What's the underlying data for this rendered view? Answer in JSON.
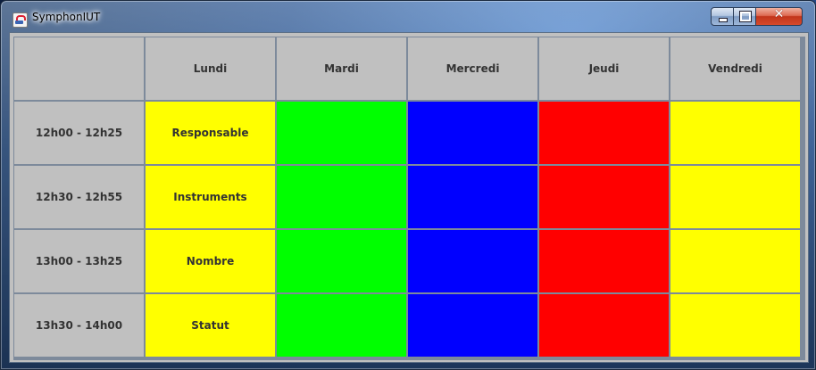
{
  "window": {
    "title": "SymphonIUT",
    "close_glyph": "✕"
  },
  "icons": {
    "app": "java-coffee-cup-icon",
    "minimize": "minimize-icon",
    "maximize": "maximize-icon",
    "close": "close-icon"
  },
  "colors": {
    "header_bg": "#c0c0c0",
    "lundi": "#ffff00",
    "mardi": "#00ff00",
    "mercredi": "#0000ff",
    "jeudi": "#ff0000",
    "vendredi": "#ffff00"
  },
  "table": {
    "corner": "",
    "days": [
      "Lundi",
      "Mardi",
      "Mercredi",
      "Jeudi",
      "Vendredi"
    ],
    "rows": [
      {
        "time": "12h00 - 12h25",
        "cells": [
          "Responsable",
          "",
          "",
          "",
          ""
        ]
      },
      {
        "time": "12h30 - 12h55",
        "cells": [
          "Instruments",
          "",
          "",
          "",
          ""
        ]
      },
      {
        "time": "13h00 - 13h25",
        "cells": [
          "Nombre",
          "",
          "",
          "",
          ""
        ]
      },
      {
        "time": "13h30 - 14h00",
        "cells": [
          "Statut",
          "",
          "",
          "",
          ""
        ]
      }
    ]
  }
}
